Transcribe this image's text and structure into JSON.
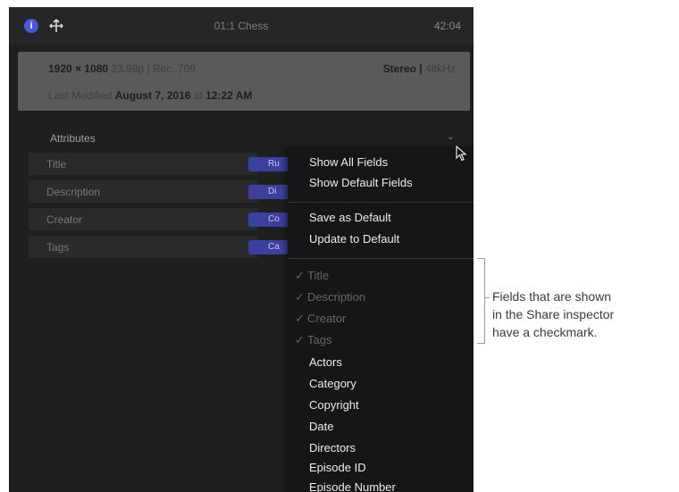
{
  "topbar": {
    "title": "01:1 Chess",
    "duration": "42:04"
  },
  "summary": {
    "format_bold": "1920 × 1080",
    "format_rest": "23.98p | Rec. 709",
    "audio_label": "Stereo |",
    "audio_value": "48kHz",
    "modified_prefix": "Last Modified",
    "modified_date": "August 7, 2016",
    "modified_at": "at",
    "modified_time": "12:22 AM"
  },
  "attributes": {
    "heading": "Attributes",
    "rows": [
      {
        "label": "Title",
        "value": "Ru"
      },
      {
        "label": "Description",
        "value": "Di"
      },
      {
        "label": "Creator",
        "value": "Co"
      },
      {
        "label": "Tags",
        "value": "Ca"
      }
    ]
  },
  "menu": {
    "show_all": "Show All Fields",
    "show_default": "Show Default Fields",
    "save_default": "Save as Default",
    "update_default": "Update to Default",
    "checkmark": "✓",
    "checked_fields": [
      "Title",
      "Description",
      "Creator",
      "Tags"
    ],
    "fields": [
      "Actors",
      "Category",
      "Copyright",
      "Date",
      "Directors",
      "Episode ID",
      "Episode Number"
    ]
  },
  "callout": {
    "line1": "Fields that are shown",
    "line2": "in the Share inspector",
    "line3": "have a checkmark."
  },
  "colors": {
    "panel_bg": "#1f1f21",
    "menu_bg": "#161618",
    "accent": "#4b57d8"
  }
}
